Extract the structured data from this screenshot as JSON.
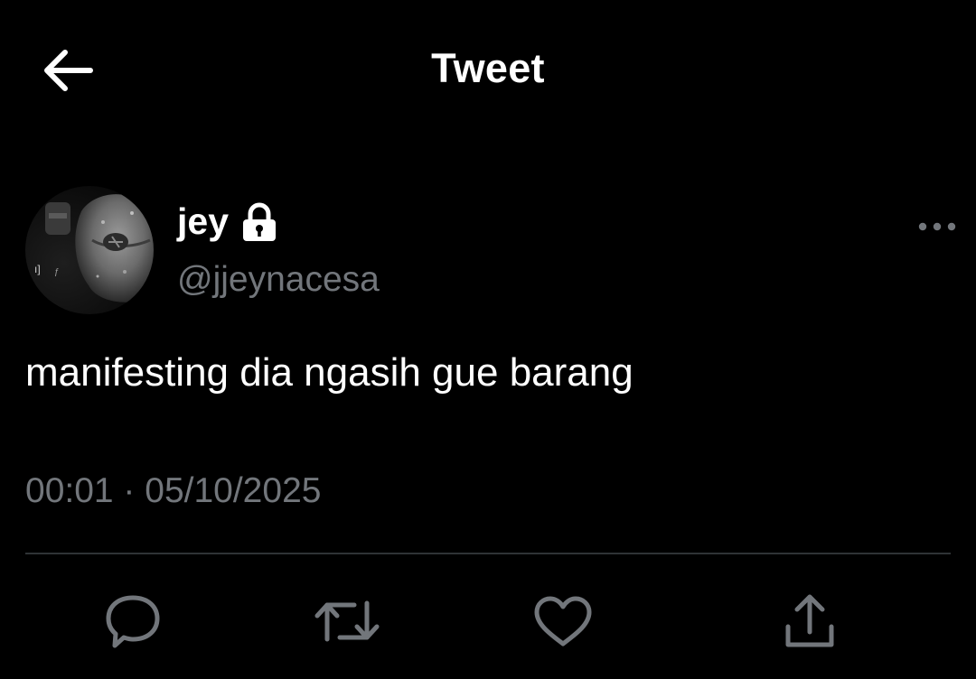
{
  "header": {
    "title": "Tweet",
    "back_icon": "arrow-left-icon"
  },
  "tweet": {
    "author": {
      "display_name": "jey",
      "handle": "@jjeynacesa",
      "protected": true,
      "lock_icon": "lock-icon"
    },
    "text": "manifesting dia ngasih gue barang",
    "timestamp": "00:01 · 05/10/2025",
    "more_icon": "more-horizontal-icon"
  },
  "actions": [
    {
      "name": "reply",
      "icon": "reply-icon"
    },
    {
      "name": "retweet",
      "icon": "retweet-icon"
    },
    {
      "name": "like",
      "icon": "heart-icon"
    },
    {
      "name": "share",
      "icon": "share-icon"
    }
  ],
  "colors": {
    "background": "#000000",
    "primary_text": "#ffffff",
    "secondary_text": "#72767b",
    "icon": "#72767b",
    "divider": "#2f3336"
  }
}
